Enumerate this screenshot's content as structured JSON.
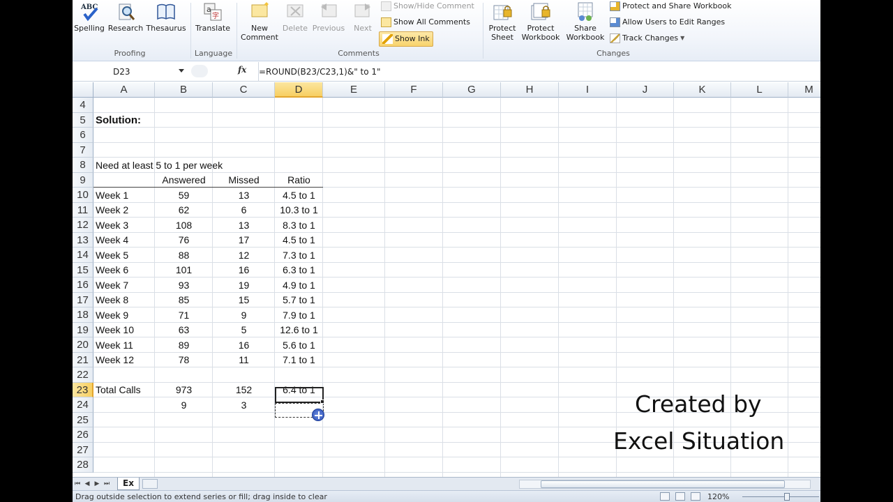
{
  "ribbon": {
    "proofing": {
      "spelling": "Spelling",
      "research": "Research",
      "thesaurus": "Thesaurus",
      "group": "Proofing"
    },
    "language": {
      "translate": "Translate",
      "group": "Language"
    },
    "comments": {
      "new_comment_line1": "New",
      "new_comment_line2": "Comment",
      "delete": "Delete",
      "previous": "Previous",
      "next": "Next",
      "show_hide_comment": "Show/Hide Comment",
      "show_all_comments": "Show All Comments",
      "show_ink": "Show Ink",
      "group": "Comments"
    },
    "changes": {
      "protect_sheet_line1": "Protect",
      "protect_sheet_line2": "Sheet",
      "protect_workbook_line1": "Protect",
      "protect_workbook_line2": "Workbook",
      "share_workbook_line1": "Share",
      "share_workbook_line2": "Workbook",
      "protect_and_share": "Protect and Share Workbook",
      "allow_users": "Allow Users to Edit Ranges",
      "track_changes": "Track Changes",
      "group": "Changes"
    }
  },
  "formula_bar": {
    "name_box": "D23",
    "fx_label": "fx",
    "formula": "=ROUND(B23/C23,1)&\" to 1\""
  },
  "sheet": {
    "columns": [
      "A",
      "B",
      "C",
      "D",
      "E",
      "F",
      "G",
      "H",
      "I",
      "J",
      "K",
      "L",
      "M"
    ],
    "selected_column": "D",
    "rows": [
      "4",
      "5",
      "6",
      "7",
      "8",
      "9",
      "10",
      "11",
      "12",
      "13",
      "14",
      "15",
      "16",
      "17",
      "18",
      "19",
      "20",
      "21",
      "22",
      "23",
      "24",
      "25",
      "26",
      "27",
      "28"
    ],
    "selected_row": "23",
    "solution_label": "Solution:",
    "need_label": "Need at least 5 to 1 per week",
    "headers": {
      "answered": "Answered",
      "missed": "Missed",
      "ratio": "Ratio"
    },
    "weeks": [
      {
        "week": "Week 1",
        "answered": "59",
        "missed": "13",
        "ratio": "4.5 to 1"
      },
      {
        "week": "Week 2",
        "answered": "62",
        "missed": "6",
        "ratio": "10.3 to 1"
      },
      {
        "week": "Week 3",
        "answered": "108",
        "missed": "13",
        "ratio": "8.3 to 1"
      },
      {
        "week": "Week 4",
        "answered": "76",
        "missed": "17",
        "ratio": "4.5 to 1"
      },
      {
        "week": "Week 5",
        "answered": "88",
        "missed": "12",
        "ratio": "7.3 to 1"
      },
      {
        "week": "Week 6",
        "answered": "101",
        "missed": "16",
        "ratio": "6.3 to 1"
      },
      {
        "week": "Week 7",
        "answered": "93",
        "missed": "19",
        "ratio": "4.9 to 1"
      },
      {
        "week": "Week 8",
        "answered": "85",
        "missed": "15",
        "ratio": "5.7 to 1"
      },
      {
        "week": "Week 9",
        "answered": "71",
        "missed": "9",
        "ratio": "7.9 to 1"
      },
      {
        "week": "Week 10",
        "answered": "63",
        "missed": "5",
        "ratio": "12.6 to 1"
      },
      {
        "week": "Week 11",
        "answered": "89",
        "missed": "16",
        "ratio": "5.6 to 1"
      },
      {
        "week": "Week 12",
        "answered": "78",
        "missed": "11",
        "ratio": "7.1 to 1"
      }
    ],
    "total": {
      "label": "Total Calls",
      "answered": "973",
      "missed": "152",
      "ratio": "6.4 to 1"
    },
    "row24": {
      "answered": "9",
      "missed": "3"
    }
  },
  "watermark": {
    "line1": "Created by",
    "line2": "Excel Situation"
  },
  "tabs": {
    "active_sheet": "Ex"
  },
  "status_bar": {
    "message": "Drag outside selection to extend series or fill; drag inside to clear",
    "zoom": "120%"
  }
}
